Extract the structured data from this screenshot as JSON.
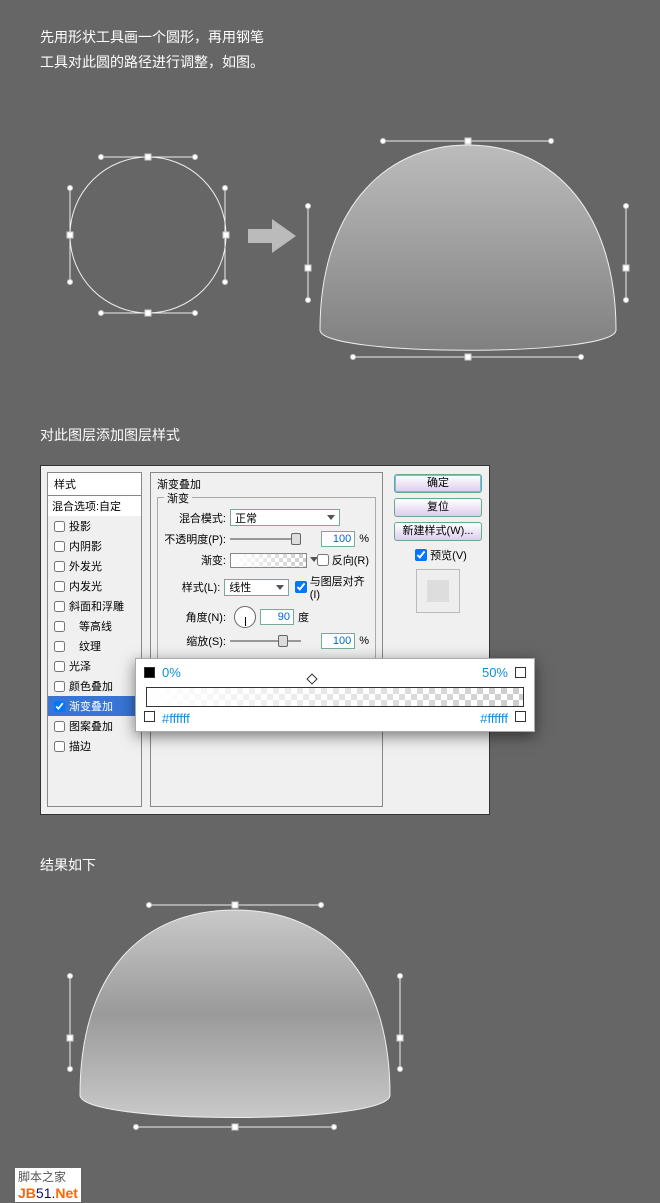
{
  "intro": {
    "line1": "先用形状工具画一个圆形，再用钢笔",
    "line2": "工具对此圆的路径进行调整，如图。"
  },
  "heading2": "对此图层添加图层样式",
  "dialog": {
    "styles_header": "样式",
    "blending_defaults": "混合选项:自定",
    "style_items": [
      {
        "label": "投影",
        "checked": false,
        "active": false
      },
      {
        "label": "内阴影",
        "checked": false,
        "active": false
      },
      {
        "label": "外发光",
        "checked": false,
        "active": false
      },
      {
        "label": "内发光",
        "checked": false,
        "active": false
      },
      {
        "label": "斜面和浮雕",
        "checked": false,
        "active": false
      },
      {
        "label": "等高线",
        "checked": false,
        "active": false,
        "indent": true
      },
      {
        "label": "纹理",
        "checked": false,
        "active": false,
        "indent": true
      },
      {
        "label": "光泽",
        "checked": false,
        "active": false
      },
      {
        "label": "颜色叠加",
        "checked": false,
        "active": false
      },
      {
        "label": "渐变叠加",
        "checked": true,
        "active": true
      },
      {
        "label": "图案叠加",
        "checked": false,
        "active": false
      },
      {
        "label": "描边",
        "checked": false,
        "active": false
      }
    ],
    "section_title": "渐变叠加",
    "group_legend": "渐变",
    "blend_mode_label": "混合模式:",
    "blend_mode_value": "正常",
    "opacity_label": "不透明度(P):",
    "opacity_value": "100",
    "opacity_unit": "%",
    "gradient_label": "渐变:",
    "reverse_label": "反向(R)",
    "style_label": "样式(L):",
    "style_value": "线性",
    "align_label": "与图层对齐(I)",
    "angle_label": "角度(N):",
    "angle_value": "90",
    "angle_unit": "度",
    "scale_label": "缩放(S):",
    "scale_value": "100",
    "scale_unit": "%",
    "btn_ok": "确定",
    "btn_reset": "复位",
    "btn_newstyle": "新建样式(W)...",
    "preview_label": "预览(V)"
  },
  "grad_editor": {
    "left_opacity": "0%",
    "right_opacity": "50%",
    "left_hex": "#ffffff",
    "right_hex": "#ffffff"
  },
  "heading3": "结果如下",
  "footer": {
    "line1": "脚本之家",
    "brand_left": "JB",
    "brand_mid": "51.",
    "brand_right": "Net"
  }
}
